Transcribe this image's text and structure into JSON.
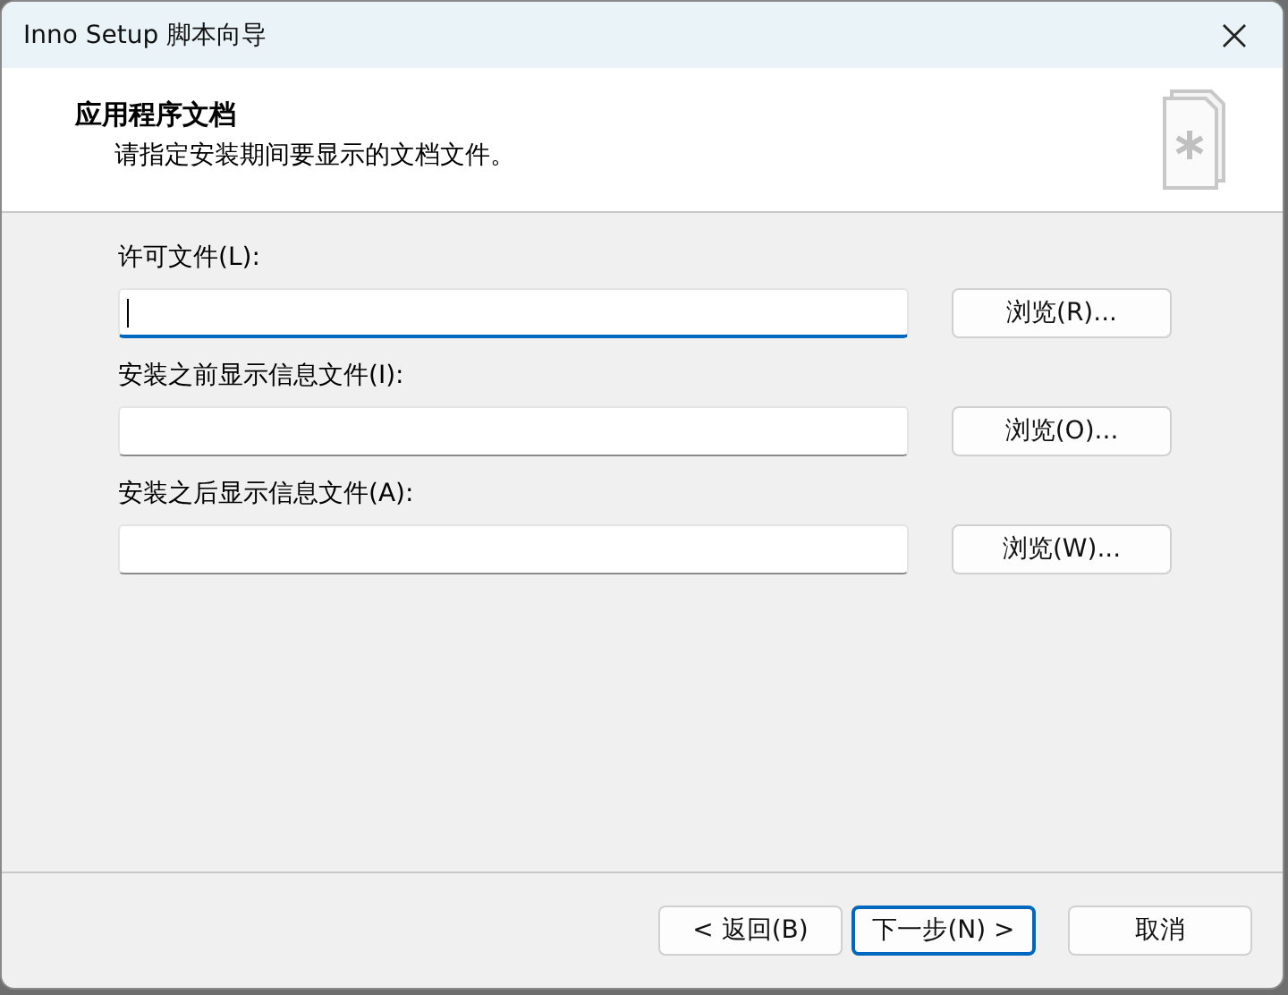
{
  "window": {
    "title": "Inno Setup 脚本向导"
  },
  "header": {
    "title": "应用程序文档",
    "subtitle": "请指定安装期间要显示的文档文件。"
  },
  "fields": [
    {
      "label": "许可文件(L):",
      "focused": true,
      "browse": "浏览(R)..."
    },
    {
      "label": "安装之前显示信息文件(I):",
      "focused": false,
      "browse": "浏览(O)..."
    },
    {
      "label": "安装之后显示信息文件(A):",
      "focused": false,
      "browse": "浏览(W)..."
    }
  ],
  "buttons": [
    {
      "label": "< 返回(B)",
      "default": false
    },
    {
      "label": "下一步(N) >",
      "default": true
    },
    {
      "label": "取消",
      "default": false
    }
  ]
}
